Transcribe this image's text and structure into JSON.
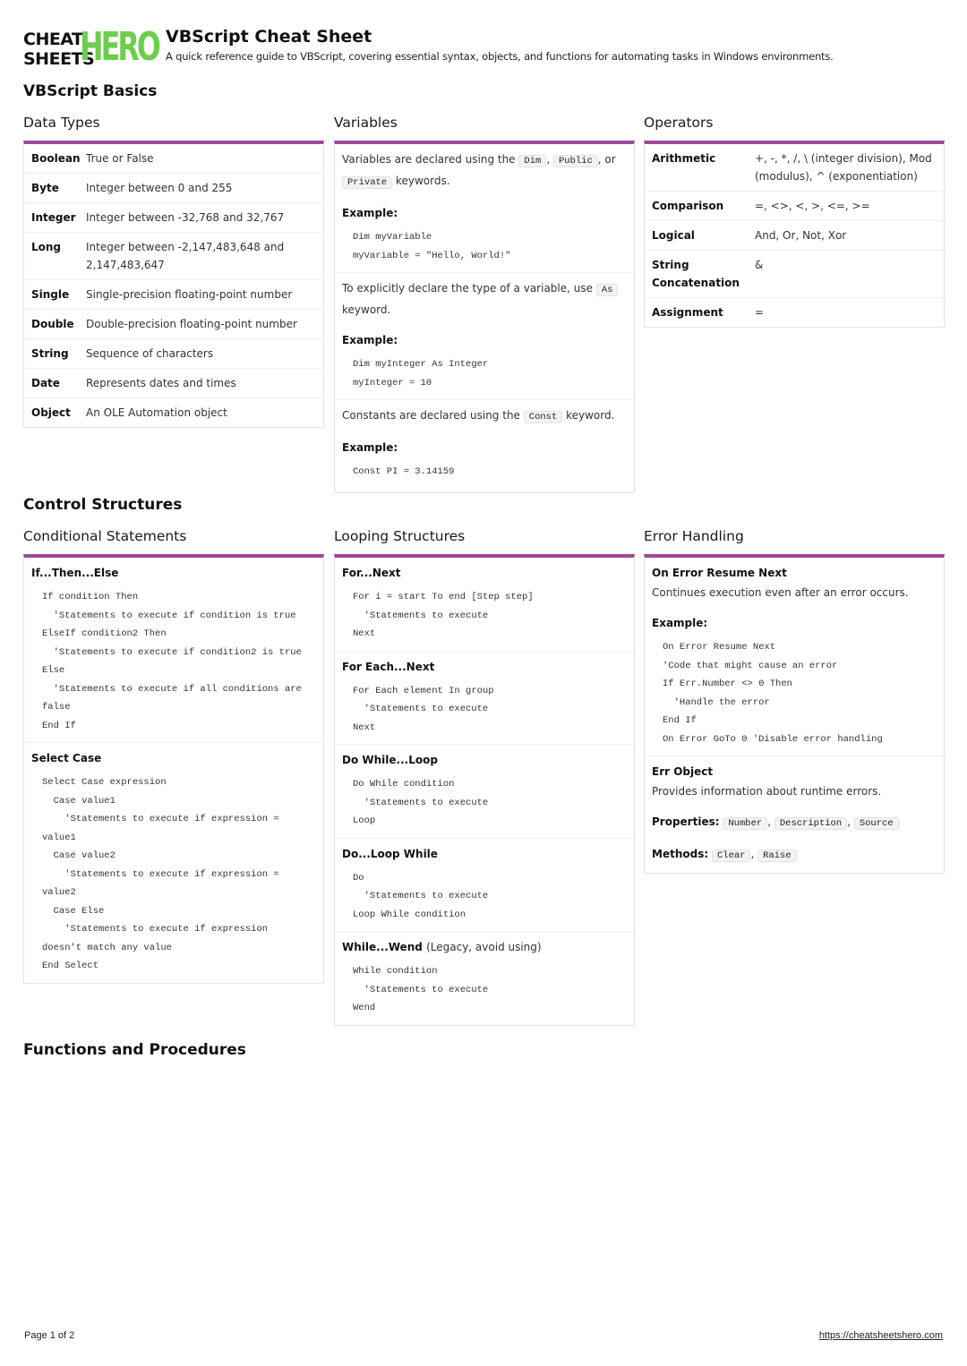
{
  "header": {
    "logo_top": "CHEAT",
    "logo_bottom": "SHEETS",
    "logo_hero": "HERO",
    "title": "VBScript Cheat Sheet",
    "subtitle": "A quick reference guide to VBScript, covering essential syntax, objects, and functions for automating tasks in Windows environments."
  },
  "colors": {
    "accent": "#9b4a99",
    "logo_green": "#6ccd4e"
  },
  "sections": {
    "basics": "VBScript Basics",
    "control": "Control Structures",
    "functions": "Functions and Procedures"
  },
  "data_types": {
    "title": "Data Types",
    "rows": [
      {
        "key": "Boolean",
        "value": "True or False"
      },
      {
        "key": "Byte",
        "value": "Integer between 0 and 255"
      },
      {
        "key": "Integer",
        "value": "Integer between -32,768 and 32,767"
      },
      {
        "key": "Long",
        "value": "Integer between -2,147,483,648 and 2,147,483,647"
      },
      {
        "key": "Single",
        "value": "Single-precision floating-point number"
      },
      {
        "key": "Double",
        "value": "Double-precision floating-point number"
      },
      {
        "key": "String",
        "value": "Sequence of characters"
      },
      {
        "key": "Date",
        "value": "Represents dates and times"
      },
      {
        "key": "Object",
        "value": "An OLE Automation object"
      }
    ]
  },
  "variables": {
    "title": "Variables",
    "b1": {
      "text1": "Variables are declared using the",
      "kw1": "Dim",
      "sep1": ",",
      "kw2": "Public",
      "sep2": ", or",
      "kw3": "Private",
      "text2": "keywords.",
      "example_label": "Example:",
      "code": [
        "Dim myVariable",
        "myVariable = \"Hello, World!\""
      ]
    },
    "b2": {
      "text1": "To explicitly declare the type of a variable, use",
      "kw1": "As",
      "text2": "keyword.",
      "example_label": "Example:",
      "code": [
        "Dim myInteger As Integer",
        "myInteger = 10"
      ]
    },
    "b3": {
      "text1": "Constants are declared using the",
      "kw1": "Const",
      "text2": "keyword.",
      "example_label": "Example:",
      "code": [
        "Const PI = 3.14159"
      ]
    }
  },
  "operators": {
    "title": "Operators",
    "rows": [
      {
        "key": "Arithmetic",
        "value": "+, -, *, /, \\ (integer division), Mod (modulus), ^ (exponentiation)"
      },
      {
        "key": "Comparison",
        "value": "=, <>, <, >, <=, >="
      },
      {
        "key": "Logical",
        "value": "And, Or, Not, Xor"
      },
      {
        "key": "String Concatenation",
        "value": "&"
      },
      {
        "key": "Assignment",
        "value": "="
      }
    ]
  },
  "conditional": {
    "title": "Conditional Statements",
    "blocks": [
      {
        "heading": "If...Then...Else",
        "code": [
          "If condition Then",
          "  'Statements to execute if condition is true",
          "ElseIf condition2 Then",
          "  'Statements to execute if condition2 is true",
          "Else",
          "  'Statements to execute if all conditions are",
          "false",
          "End If"
        ]
      },
      {
        "heading": "Select Case",
        "code": [
          "Select Case expression",
          "  Case value1",
          "    'Statements to execute if expression =",
          "value1",
          "  Case value2",
          "    'Statements to execute if expression =",
          "value2",
          "  Case Else",
          "    'Statements to execute if expression",
          "doesn't match any value",
          "End Select"
        ]
      }
    ]
  },
  "looping": {
    "title": "Looping Structures",
    "blocks": [
      {
        "heading": "For...Next",
        "note": "",
        "code": [
          "For i = start To end [Step step]",
          "  'Statements to execute",
          "Next"
        ]
      },
      {
        "heading": "For Each...Next",
        "note": "",
        "code": [
          "For Each element In group",
          "  'Statements to execute",
          "Next"
        ]
      },
      {
        "heading": "Do While...Loop",
        "note": "",
        "code": [
          "Do While condition",
          "  'Statements to execute",
          "Loop"
        ]
      },
      {
        "heading": "Do...Loop While",
        "note": "",
        "code": [
          "Do",
          "  'Statements to execute",
          "Loop While condition"
        ]
      },
      {
        "heading": "While...Wend",
        "note": "(Legacy, avoid using)",
        "code": [
          "While condition",
          "  'Statements to execute",
          "Wend"
        ]
      }
    ]
  },
  "error_handling": {
    "title": "Error Handling",
    "b1": {
      "heading": "On Error Resume Next",
      "desc": "Continues execution even after an error occurs.",
      "example_label": "Example:",
      "code": [
        "On Error Resume Next",
        "'Code that might cause an error",
        "If Err.Number <> 0 Then",
        "  'Handle the error",
        "End If",
        "On Error GoTo 0 'Disable error handling"
      ]
    },
    "b2": {
      "heading": "Err Object",
      "desc": "Provides information about runtime errors.",
      "properties_label": "Properties:",
      "properties": [
        "Number",
        "Description",
        "Source"
      ],
      "methods_label": "Methods:",
      "methods": [
        "Clear",
        "Raise"
      ],
      "sep": ","
    }
  },
  "footer": {
    "page": "Page 1 of 2",
    "url": "https://cheatsheetshero.com"
  }
}
